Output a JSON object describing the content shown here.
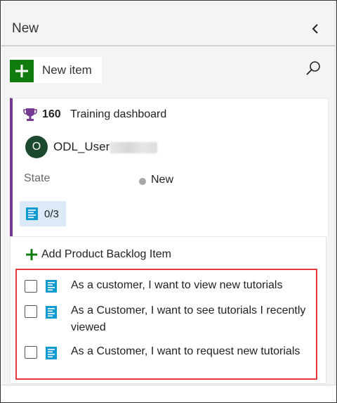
{
  "column": {
    "title": "New"
  },
  "toolbar": {
    "new_item_label": "New item"
  },
  "card": {
    "id": "160",
    "title": "Training dashboard",
    "avatar_initial": "O",
    "assignee": "ODL_User",
    "state_label": "State",
    "state_value": "New",
    "state_color": "#a6a6a6",
    "accent_color": "#773b93",
    "child_count": "0/3"
  },
  "add_item": {
    "label": "Add Product Backlog Item"
  },
  "tasks": [
    {
      "text": "As a customer, I want to view new tutorials"
    },
    {
      "text": "As a Customer, I want to see tutorials I recently viewed"
    },
    {
      "text": "As a Customer, I want to request new tutorials"
    }
  ],
  "icons": {
    "collapse": "chevron-left-icon",
    "new_item": "plus-icon",
    "search": "search-icon",
    "work_item": "trophy-icon",
    "child": "task-list-icon"
  }
}
